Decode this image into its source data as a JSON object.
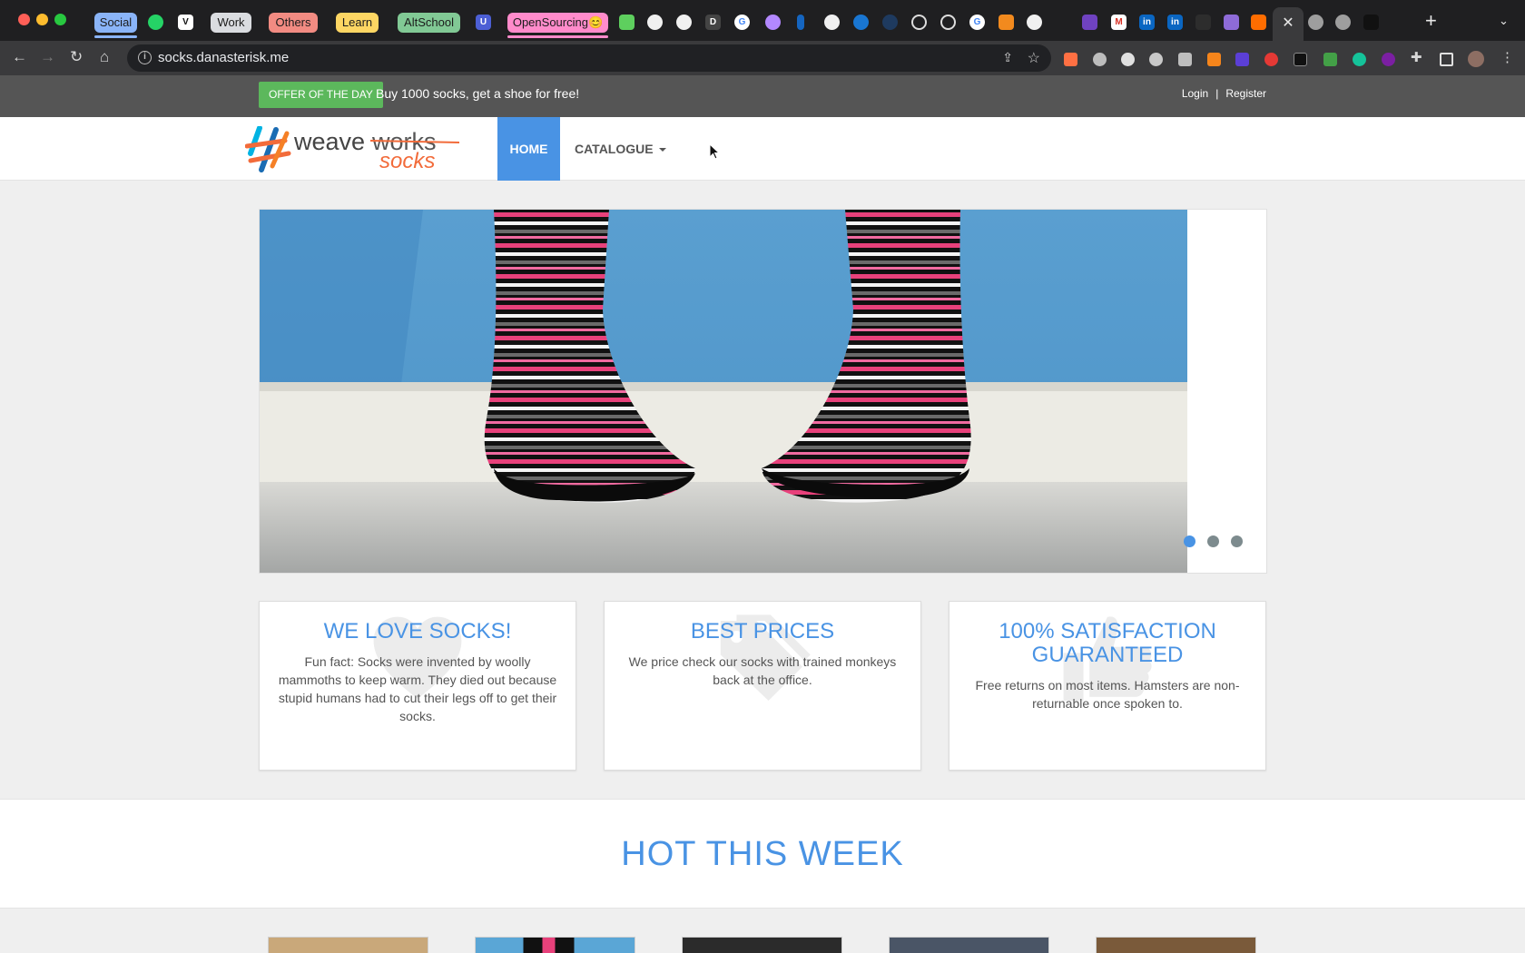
{
  "browser": {
    "tab_groups": [
      {
        "label": "Social",
        "color": "#8ab4f8"
      },
      {
        "label": "Work",
        "color": "#dadce0"
      },
      {
        "label": "Others",
        "color": "#f28b82"
      },
      {
        "label": "Learn",
        "color": "#fdd663"
      },
      {
        "label": "AltSchool",
        "color": "#81c995"
      },
      {
        "label": "OpenSourcing😊",
        "color": "#ff8bcb"
      }
    ],
    "active_tab_close": "✕",
    "new_tab": "+",
    "url": "socks.danasterisk.me"
  },
  "offer": {
    "badge": "OFFER OF THE DAY",
    "text": "Buy 1000 socks, get a shoe for free!"
  },
  "account": {
    "login": "Login",
    "separator": "|",
    "register": "Register"
  },
  "nav": {
    "home": "HOME",
    "catalogue": "CATALOGUE"
  },
  "logo": {
    "word1": "weave",
    "word2": "works",
    "word3": "socks"
  },
  "carousel": {
    "slide_count": 3,
    "active_slide": 1
  },
  "features": [
    {
      "title": "WE LOVE SOCKS!",
      "text": "Fun fact: Socks were invented by woolly mammoths to keep warm. They died out because stupid humans had to cut their legs off to get their socks.",
      "icon": "heart-icon"
    },
    {
      "title": "BEST PRICES",
      "text": "We price check our socks with trained monkeys back at the office.",
      "icon": "tags-icon"
    },
    {
      "title": "100% SATISFACTION GUARANTEED",
      "text": "Free returns on most items. Hamsters are non-returnable once spoken to.",
      "icon": "thumbs-up-icon"
    }
  ],
  "hot": {
    "title": "HOT THIS WEEK"
  },
  "colors": {
    "accent": "#4993e4",
    "offer_green": "#5cb85c",
    "topbar": "#555555"
  }
}
